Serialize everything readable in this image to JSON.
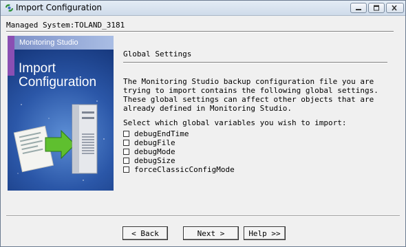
{
  "window": {
    "title": "Import Configuration",
    "icon": "app-icon",
    "controls": [
      "minimize-icon",
      "maximize-icon",
      "close-icon"
    ]
  },
  "header": {
    "managed_system": "Managed System:TOLAND_3181"
  },
  "side_panel": {
    "brand": "Monitoring Studio",
    "title_line1": "Import",
    "title_line2": "Configuration"
  },
  "main": {
    "section_title": "Global Settings",
    "description": "The Monitoring Studio backup configuration file you are\ntrying to import contains the following global settings.\nThese global settings can affect other objects that are\nalready defined in Monitoring Studio.",
    "prompt": "Select which global variables you wish to import:",
    "variables": [
      {
        "label": "debugEndTime",
        "checked": false
      },
      {
        "label": "debugFile",
        "checked": false
      },
      {
        "label": "debugMode",
        "checked": false
      },
      {
        "label": "debugSize",
        "checked": false
      },
      {
        "label": "forceClassicConfigMode",
        "checked": false
      }
    ]
  },
  "buttons": {
    "back": "< Back",
    "next": "Next >",
    "help": "Help >>"
  }
}
